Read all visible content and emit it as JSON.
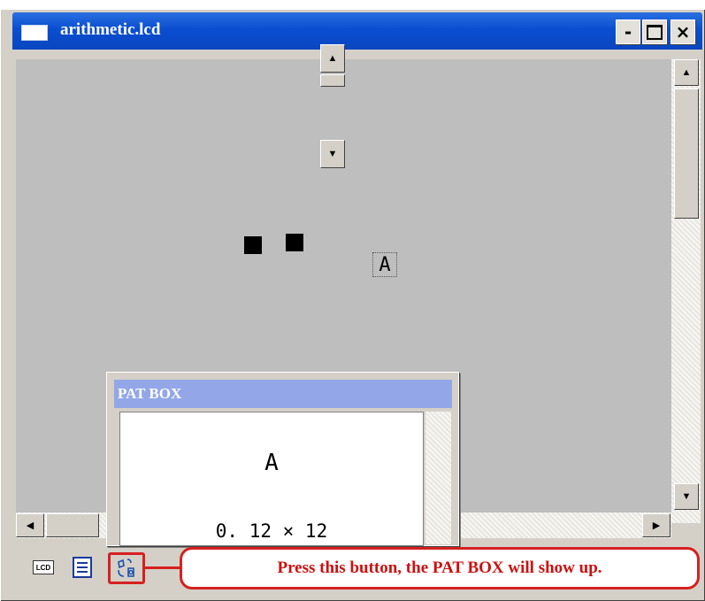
{
  "window": {
    "title": "arithmetic.lcd",
    "minimize_label": "-",
    "close_label": "×"
  },
  "canvas": {
    "glyph": "A"
  },
  "pat_box": {
    "title": "PAT BOX",
    "glyph": "A",
    "size_label": "0. 12 × 12"
  },
  "toolbar": {
    "lcd_label": "LCD"
  },
  "callout": {
    "text": "Press this button, the PAT BOX will show up."
  },
  "colors": {
    "title_bar": "#0a4ed0",
    "pat_title_bar": "#93a7e8",
    "canvas_bg": "#bebebe",
    "highlight": "#d62020"
  },
  "icons": [
    "window-icon",
    "minimize-icon",
    "maximize-icon",
    "close-icon",
    "lcd-icon",
    "list-icon",
    "pattern-icon",
    "scroll-up-icon",
    "scroll-down-icon",
    "scroll-left-icon",
    "scroll-right-icon"
  ]
}
